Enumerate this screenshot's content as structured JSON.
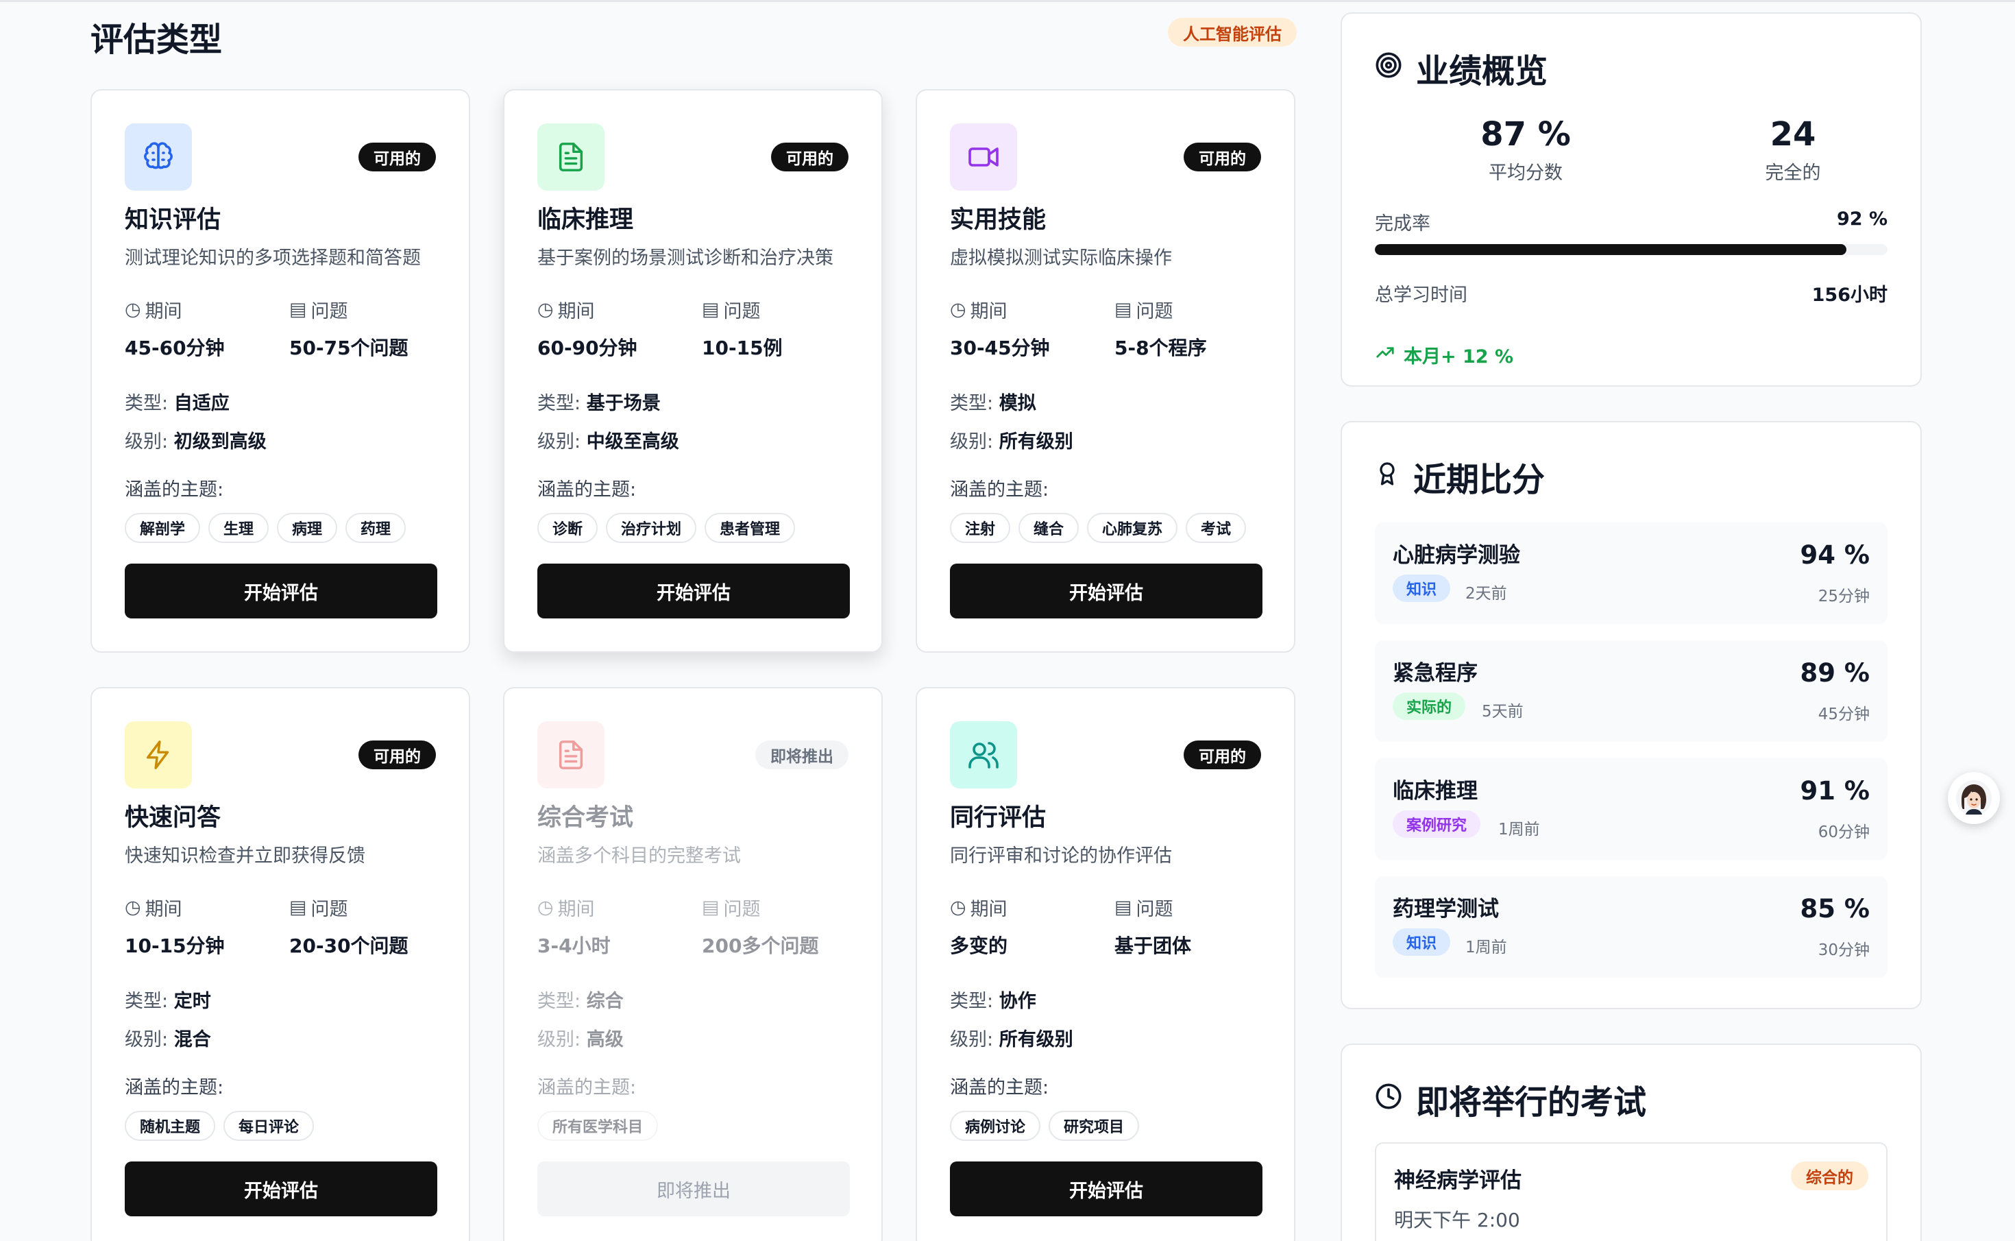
{
  "header": {
    "title": "评估类型",
    "ai_badge": "人工智能评估"
  },
  "labels": {
    "duration": "期间",
    "questions": "问题",
    "type": "类型:",
    "level": "级别:",
    "topics": "涵盖的主题:"
  },
  "cards": [
    {
      "title": "知识评估",
      "status": "可用的",
      "description": "测试理论知识的多项选择题和简答题",
      "duration": "45-60分钟",
      "questions": "50-75个问题",
      "type": "自适应",
      "level": "初级到高级",
      "topics": [
        "解剖学",
        "生理",
        "病理",
        "药理"
      ],
      "button": "开始评估",
      "icon": "brain-icon",
      "icon_color": "#2563eb",
      "icon_bg": "#dbeafe"
    },
    {
      "title": "临床推理",
      "status": "可用的",
      "description": "基于案例的场景测试诊断和治疗决策",
      "duration": "60-90分钟",
      "questions": "10-15例",
      "type": "基于场景",
      "level": "中级至高级",
      "topics": [
        "诊断",
        "治疗计划",
        "患者管理"
      ],
      "button": "开始评估",
      "icon": "document-icon",
      "icon_color": "#16a34a",
      "icon_bg": "#dcfce7"
    },
    {
      "title": "实用技能",
      "status": "可用的",
      "description": "虚拟模拟测试实际临床操作",
      "duration": "30-45分钟",
      "questions": "5-8个程序",
      "type": "模拟",
      "level": "所有级别",
      "topics": [
        "注射",
        "缝合",
        "心肺复苏",
        "考试"
      ],
      "button": "开始评估",
      "icon": "video-camera-icon",
      "icon_color": "#9333ea",
      "icon_bg": "#f3e8ff"
    },
    {
      "title": "快速问答",
      "status": "可用的",
      "description": "快速知识检查并立即获得反馈",
      "duration": "10-15分钟",
      "questions": "20-30个问题",
      "type": "定时",
      "level": "混合",
      "topics": [
        "随机主题",
        "每日评论"
      ],
      "button": "开始评估",
      "icon": "lightning-icon",
      "icon_color": "#ca8a04",
      "icon_bg": "#fef9c3"
    },
    {
      "title": "综合考试",
      "status": "即将推出",
      "description": "涵盖多个科目的完整考试",
      "duration": "3-4小时",
      "questions": "200多个问题",
      "type": "综合",
      "level": "高级",
      "topics": [
        "所有医学科目"
      ],
      "button": "即将推出",
      "icon": "document-icon",
      "icon_color": "#dc2626",
      "icon_bg": "#fee2e2"
    },
    {
      "title": "同行评估",
      "status": "可用的",
      "description": "同行评审和讨论的协作评估",
      "duration": "多变的",
      "questions": "基于团体",
      "type": "协作",
      "level": "所有级别",
      "topics": [
        "病例讨论",
        "研究项目"
      ],
      "button": "开始评估",
      "icon": "users-icon",
      "icon_color": "#0d9488",
      "icon_bg": "#ccfbf1"
    }
  ],
  "overview": {
    "title": "业绩概览",
    "avg_score": "87 %",
    "avg_score_label": "平均分数",
    "completed": "24",
    "completed_label": "完全的",
    "completion_label": "完成率",
    "completion_value": "92 %",
    "completion_fraction": 0.92,
    "study_time_label": "总学习时间",
    "study_time_value": "156小时",
    "trend": "本月+ 12 %"
  },
  "recent_scores": {
    "title": "近期比分",
    "items": [
      {
        "name": "心脏病学测验",
        "tag": "知识",
        "when": "2天前",
        "score": "94 %",
        "duration": "25分钟",
        "tag_bg": "#dbeafe",
        "tag_color": "#2563eb"
      },
      {
        "name": "紧急程序",
        "tag": "实际的",
        "when": "5天前",
        "score": "89 %",
        "duration": "45分钟",
        "tag_bg": "#dcfce7",
        "tag_color": "#16a34a"
      },
      {
        "name": "临床推理",
        "tag": "案例研究",
        "when": "1周前",
        "score": "91 %",
        "duration": "60分钟",
        "tag_bg": "#f3e8ff",
        "tag_color": "#9333ea"
      },
      {
        "name": "药理学测试",
        "tag": "知识",
        "when": "1周前",
        "score": "85 %",
        "duration": "30分钟",
        "tag_bg": "#dbeafe",
        "tag_color": "#2563eb"
      }
    ]
  },
  "upcoming": {
    "title": "即将举行的考试",
    "items": [
      {
        "name": "神经病学评估",
        "time": "明天下午 2:00",
        "badge": "综合的"
      }
    ]
  }
}
